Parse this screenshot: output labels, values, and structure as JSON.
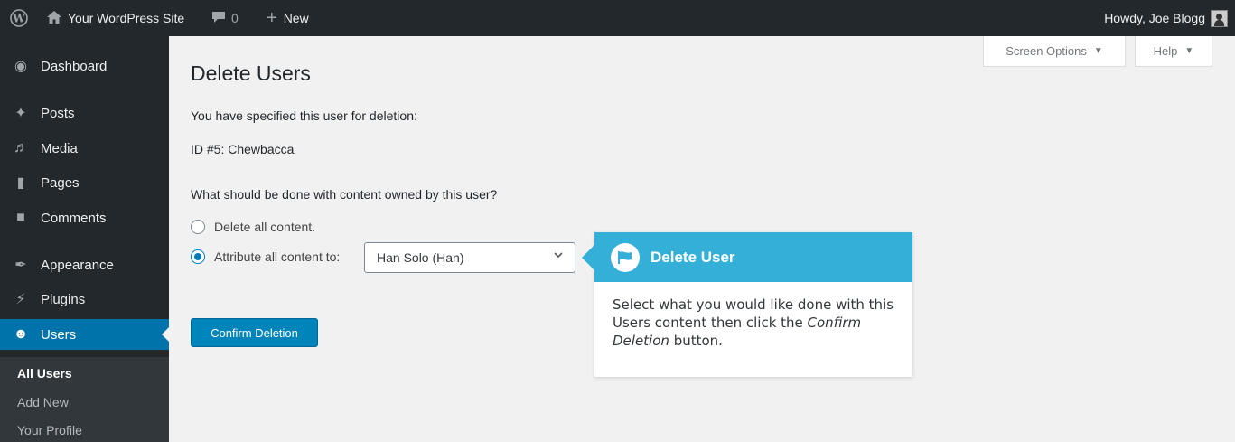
{
  "adminbar": {
    "wp_icon": "wordpress-logo-icon",
    "site_name": "Your WordPress Site",
    "comments_count": "0",
    "new_label": "New",
    "howdy": "Howdy, Joe Blogg"
  },
  "sidebar": {
    "items": [
      {
        "label": "Dashboard",
        "icon": "dashboard-icon"
      },
      {
        "label": "Posts",
        "icon": "pin-icon"
      },
      {
        "label": "Media",
        "icon": "media-icon"
      },
      {
        "label": "Pages",
        "icon": "pages-icon"
      },
      {
        "label": "Comments",
        "icon": "comment-icon"
      },
      {
        "label": "Appearance",
        "icon": "brush-icon"
      },
      {
        "label": "Plugins",
        "icon": "plugin-icon"
      },
      {
        "label": "Users",
        "icon": "users-icon"
      }
    ],
    "submenu": [
      "All Users",
      "Add New",
      "Your Profile"
    ]
  },
  "screen_meta": {
    "screen_options": "Screen Options",
    "help": "Help"
  },
  "main": {
    "title": "Delete Users",
    "specified_text": "You have specified this user for deletion:",
    "user_line": "ID #5: Chewbacca",
    "question": "What should be done with content owned by this user?",
    "option_delete": "Delete all content.",
    "option_attribute": "Attribute all content to:",
    "selected_user": "Han Solo (Han)",
    "confirm_button": "Confirm Deletion"
  },
  "callout": {
    "title": "Delete User",
    "body_prefix": "Select what you would like done with this Users content then click the ",
    "body_emphasis": "Confirm Deletion",
    "body_suffix": " button."
  },
  "colors": {
    "adminbar_bg": "#23282d",
    "accent": "#0073aa",
    "button": "#0085ba",
    "callout_head": "#34b0d8"
  }
}
